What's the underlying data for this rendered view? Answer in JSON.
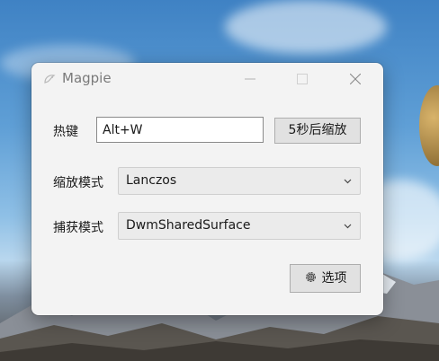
{
  "window": {
    "title": "Magpie",
    "icons": {
      "app": "magpie-icon",
      "minimize": "minimize-icon",
      "maximize": "maximize-icon",
      "close": "close-icon"
    }
  },
  "form": {
    "hotkey_label": "热键",
    "hotkey_value": "Alt+W",
    "scale_button": "5秒后缩放",
    "scale_mode_label": "缩放模式",
    "scale_mode_value": "Lanczos",
    "capture_mode_label": "捕获模式",
    "capture_mode_value": "DwmSharedSurface",
    "options_button": "选项",
    "options_icon": "gear-icon",
    "dropdown_icon": "chevron-down-icon"
  },
  "colors": {
    "window_bg": "#f3f3f3",
    "button_bg": "#e1e1e1",
    "select_bg": "#ebebeb",
    "title_text": "#7a7a7a"
  }
}
